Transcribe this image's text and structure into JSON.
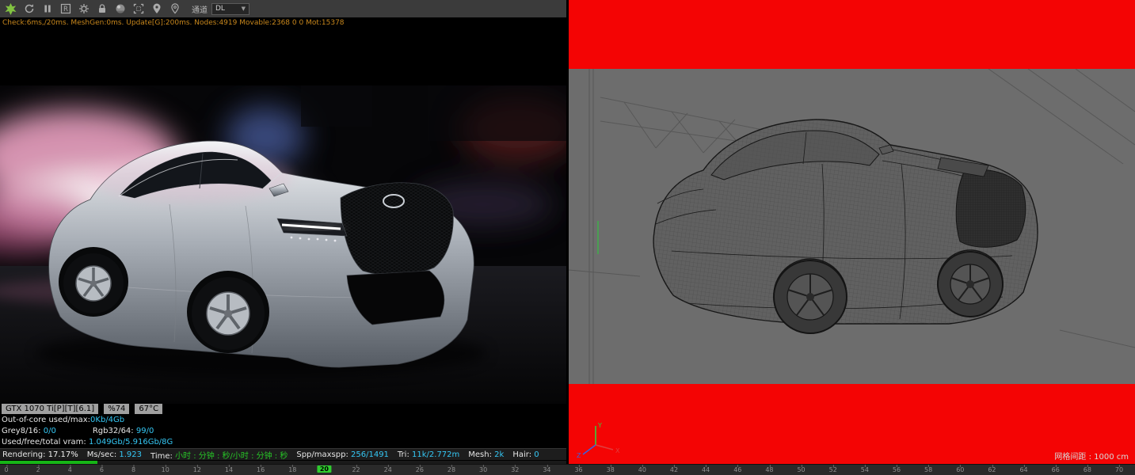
{
  "colors": {
    "accent_cyan": "#35c8f5",
    "accent_green": "#27c427",
    "perf_orange": "#c8871c",
    "viewport_red": "#f40404",
    "progress_green": "#16b516",
    "toolbar_gray": "#3b3b3b"
  },
  "toolbar": {
    "icons": [
      "octane-logo",
      "refresh",
      "pause",
      "render-target",
      "settings-gear",
      "lock",
      "material-ball",
      "region-frame",
      "pin-filled",
      "pin-outline"
    ],
    "r_icon_letter": "R",
    "channel_label": "通道",
    "channel_value": "DL",
    "dropdown_arrow": "▼"
  },
  "perf_line": "Check:6ms,/20ms. MeshGen:0ms. Update[G]:200ms. Nodes:4919 Movable:2368  0 0 Mot:15378",
  "gpu": {
    "name": "GTX 1070 Ti[P][T][6.1]",
    "load": "%74",
    "temperature": "67°C",
    "out_of_core_label": "Out-of-core used/max:",
    "out_of_core_value": "0Kb/4Gb",
    "grey_label": "Grey8/16:",
    "grey_value": "0/0",
    "rgb_label": "Rgb32/64:",
    "rgb_value": "99/0",
    "vram_label": "Used/free/total vram:",
    "vram_value": "1.049Gb/5.916Gb/8G"
  },
  "status": {
    "rendering_label": "Rendering:",
    "rendering_value": "17.17%",
    "ms_label": "Ms/sec:",
    "ms_value": "1.923",
    "time_label": "Time:",
    "time_value": "小时 : 分钟 : 秒/小时 : 分钟 : 秒",
    "spp_label": "Spp/maxspp:",
    "spp_value": "256/1491",
    "tri_label": "Tri:",
    "tri_value": "11k/2.772m",
    "mesh_label": "Mesh:",
    "mesh_value": "2k",
    "hair_label": "Hair:",
    "hair_value": "0",
    "progress_percent": 17.17
  },
  "viewport": {
    "grid_label": "网格间距 : 1000 cm",
    "axis": {
      "x": "X",
      "y": "Y",
      "z": "Z"
    }
  },
  "timeline": {
    "start": 0,
    "end": 70,
    "step": 2,
    "current_frame": 20
  }
}
